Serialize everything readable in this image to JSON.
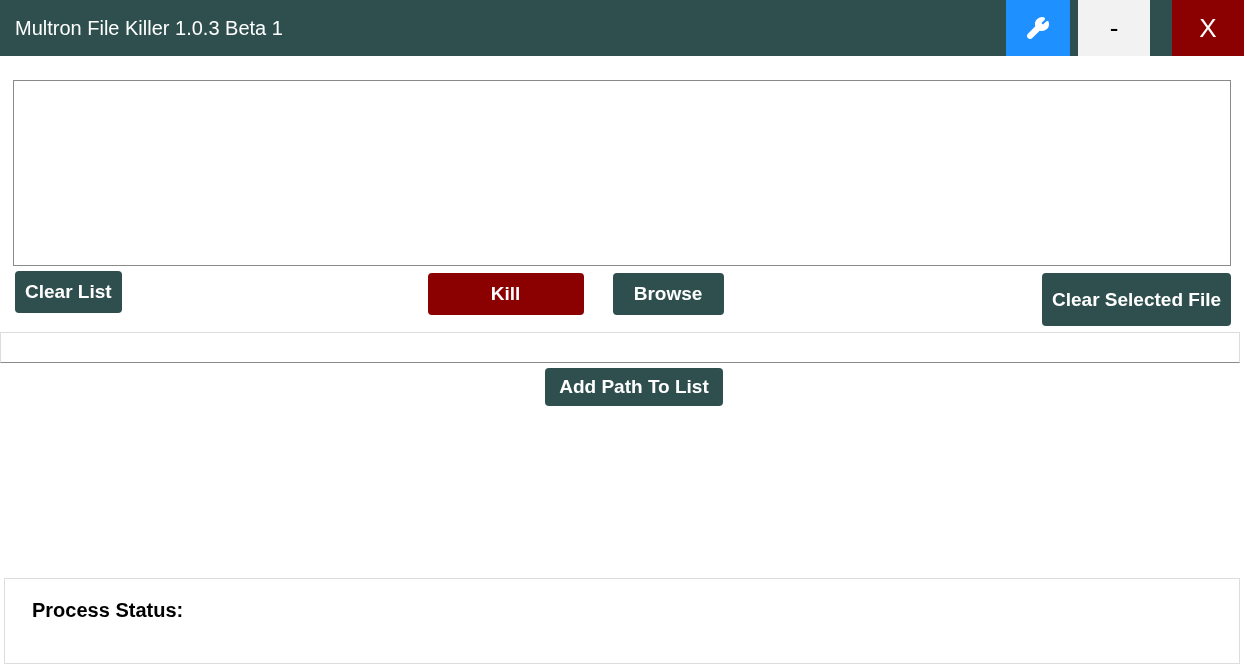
{
  "window": {
    "title": "Multron File Killer 1.0.3 Beta 1",
    "controls": [
      {
        "kind": "settings"
      },
      {
        "kind": "minimize",
        "label": "-"
      },
      {
        "kind": "close",
        "label": "X"
      }
    ]
  },
  "buttons": [
    {
      "label": "Clear List",
      "kind": "normal"
    },
    {
      "label": "Kill",
      "kind": "danger"
    },
    {
      "label": "Browse",
      "kind": "normal"
    },
    {
      "label": "Clear Selected File",
      "kind": "normal"
    }
  ],
  "add_button": {
    "label": "Add Path To List"
  },
  "status": {
    "label": "Process Status:"
  }
}
